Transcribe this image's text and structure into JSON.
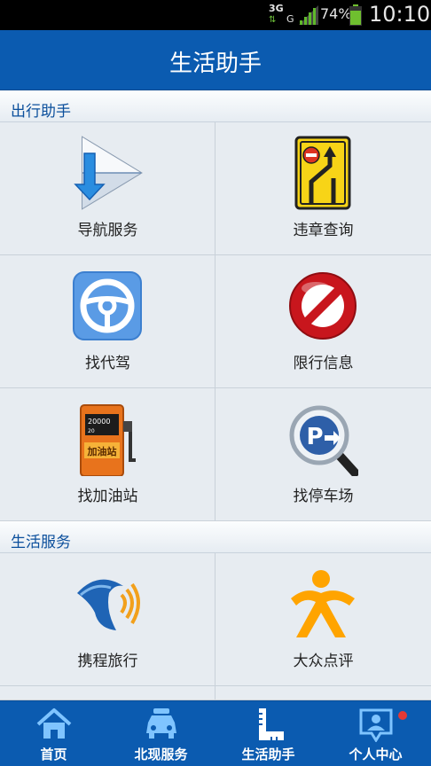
{
  "status_bar": {
    "network_type": "3G",
    "network_sub": "G",
    "battery_percent": "74%",
    "battery_level": 0.74,
    "time": "10:10"
  },
  "header": {
    "title": "生活助手"
  },
  "sections": [
    {
      "title": "出行助手",
      "items": [
        {
          "label": "导航服务",
          "icon": "navigation-icon"
        },
        {
          "label": "违章查询",
          "icon": "road-sign-icon"
        },
        {
          "label": "找代驾",
          "icon": "steering-wheel-icon"
        },
        {
          "label": "限行信息",
          "icon": "no-entry-icon"
        },
        {
          "label": "找加油站",
          "icon": "gas-pump-icon",
          "icon_text": "加油站",
          "pump_readout_1": "20000",
          "pump_readout_2": "20"
        },
        {
          "label": "找停车场",
          "icon": "parking-search-icon",
          "icon_text": "P"
        }
      ]
    },
    {
      "title": "生活服务",
      "items": [
        {
          "label": "携程旅行",
          "icon": "dolphin-icon"
        },
        {
          "label": "大众点评",
          "icon": "dianping-icon"
        }
      ]
    }
  ],
  "tab_bar": {
    "tabs": [
      {
        "label": "首页",
        "icon": "home-icon"
      },
      {
        "label": "北现服务",
        "icon": "car-service-icon"
      },
      {
        "label": "生活助手",
        "icon": "ruler-icon"
      },
      {
        "label": "个人中心",
        "icon": "profile-icon",
        "has_badge": true
      }
    ],
    "badge_color": "#e53935"
  },
  "colors": {
    "primary": "#0b5bb0",
    "section_title": "#0b4f9c",
    "grid_bg": "#e7ecf1"
  }
}
